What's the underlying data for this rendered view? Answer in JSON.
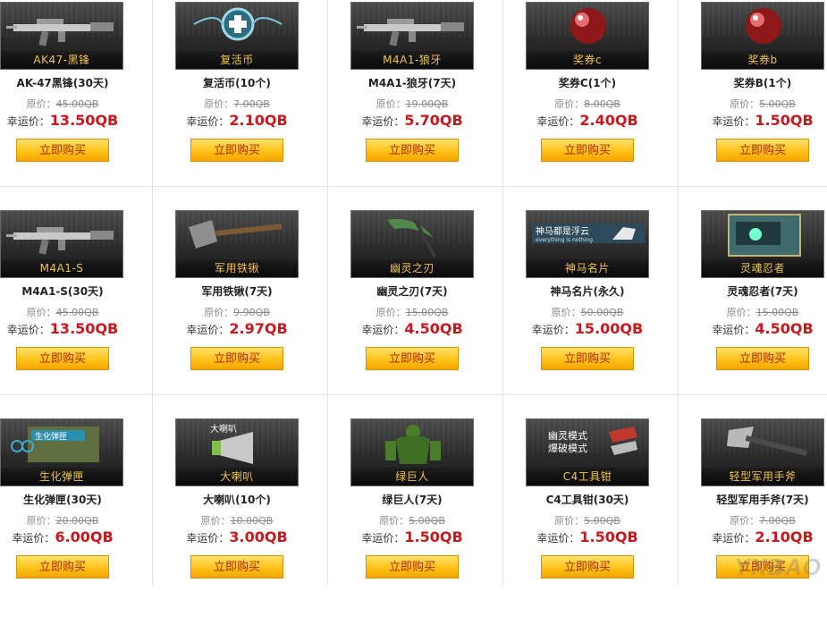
{
  "labels": {
    "orig_prefix": "原价：",
    "lucky_prefix": "幸运价：",
    "buy": "立即购买"
  },
  "watermark": "YXBAO",
  "rows": [
    [
      {
        "thumb": "AK47-黑锋",
        "name": "AK-47黑锋(30天)",
        "orig": "45.00QB",
        "lucky": "13.50QB",
        "icon": "rifle-icon"
      },
      {
        "thumb": "复活币",
        "name": "复活币(10个)",
        "orig": "7.00QB",
        "lucky": "2.10QB",
        "icon": "revive-coin-icon"
      },
      {
        "thumb": "M4A1-狼牙",
        "name": "M4A1-狼牙(7天)",
        "orig": "19.00QB",
        "lucky": "5.70QB",
        "icon": "rifle-icon"
      },
      {
        "thumb": "奖券c",
        "name": "奖券C(1个)",
        "orig": "8.00QB",
        "lucky": "2.40QB",
        "icon": "ticket-orb-icon"
      },
      {
        "thumb": "奖券b",
        "name": "奖券B(1个)",
        "orig": "5.00QB",
        "lucky": "1.50QB",
        "icon": "ticket-orb-icon"
      }
    ],
    [
      {
        "thumb": "M4A1-S",
        "name": "M4A1-S(30天)",
        "orig": "45.00QB",
        "lucky": "13.50QB",
        "icon": "rifle-icon"
      },
      {
        "thumb": "军用铁锹",
        "name": "军用铁锹(7天)",
        "orig": "9.90QB",
        "lucky": "2.97QB",
        "icon": "shovel-icon"
      },
      {
        "thumb": "幽灵之刃",
        "name": "幽灵之刃(7天)",
        "orig": "15.00QB",
        "lucky": "4.50QB",
        "icon": "scythe-icon"
      },
      {
        "thumb": "神马名片",
        "name": "神马名片(永久)",
        "orig": "50.00QB",
        "lucky": "15.00QB",
        "icon": "name-card-icon",
        "thumb_top": "神马都是浮云",
        "thumb_sub": "everything is nothing"
      },
      {
        "thumb": "灵魂忍者",
        "name": "灵魂忍者(7天)",
        "orig": "15.00QB",
        "lucky": "4.50QB",
        "icon": "ninja-card-icon"
      }
    ],
    [
      {
        "thumb": "生化弹匣",
        "name": "生化弹匣(30天)",
        "orig": "20.00QB",
        "lucky": "6.00QB",
        "icon": "ammo-box-icon",
        "thumb_tag": "生化弹匣"
      },
      {
        "thumb": "大喇叭",
        "name": "大喇叭(10个)",
        "orig": "10.00QB",
        "lucky": "3.00QB",
        "icon": "megaphone-icon",
        "thumb_tag": "大喇叭"
      },
      {
        "thumb": "绿巨人",
        "name": "绿巨人(7天)",
        "orig": "5.00QB",
        "lucky": "1.50QB",
        "icon": "green-giant-icon"
      },
      {
        "thumb": "C4工具钳",
        "name": "C4工具钳(30天)",
        "orig": "5.00QB",
        "lucky": "1.50QB",
        "icon": "pliers-icon",
        "thumb_tag": "幽灵模式\n爆破模式"
      },
      {
        "thumb": "轻型军用手斧",
        "name": "轻型军用手斧(7天)",
        "orig": "7.00QB",
        "lucky": "2.10QB",
        "icon": "hatchet-icon"
      }
    ]
  ]
}
